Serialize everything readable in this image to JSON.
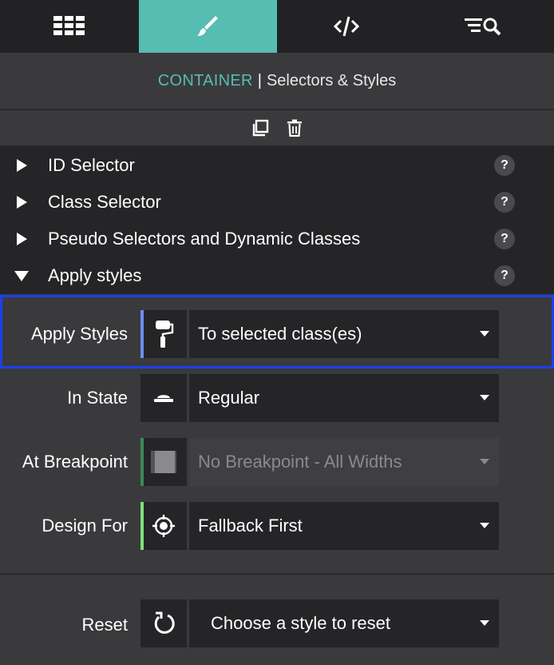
{
  "tabs": [
    {
      "name": "grid-icon",
      "active": false
    },
    {
      "name": "paintbrush-icon",
      "active": true
    },
    {
      "name": "code-icon",
      "active": false
    },
    {
      "name": "search-list-icon",
      "active": false
    }
  ],
  "header": {
    "context": "CONTAINER",
    "separator": "|",
    "title": "Selectors & Styles"
  },
  "toolbar": {
    "icons": [
      "duplicate-icon",
      "trash-icon"
    ]
  },
  "accordion": [
    {
      "label": "ID Selector",
      "expanded": false,
      "help": "?"
    },
    {
      "label": "Class Selector",
      "expanded": false,
      "help": "?"
    },
    {
      "label": "Pseudo Selectors and Dynamic Classes",
      "expanded": false,
      "help": "?"
    },
    {
      "label": "Apply styles",
      "expanded": true,
      "help": "?"
    }
  ],
  "form": {
    "apply_styles": {
      "label": "Apply Styles",
      "value": "To selected class(es)",
      "icon": "paint-roller-icon",
      "accent": "#6b8ff0"
    },
    "in_state": {
      "label": "In State",
      "value": "Regular",
      "icon": "state-icon"
    },
    "at_breakpoint": {
      "label": "At Breakpoint",
      "value": "No Breakpoint - All Widths",
      "icon": "breakpoint-icon",
      "accent": "#3c8a55",
      "disabled": true
    },
    "design_for": {
      "label": "Design For",
      "value": "Fallback First",
      "icon": "crosshair-icon",
      "accent": "#7fe07a"
    },
    "reset": {
      "label": "Reset",
      "value": "Choose a style to reset",
      "icon": "reset-icon"
    }
  },
  "colors": {
    "accent": "#56bdb3",
    "highlight_border": "#1c3ff0",
    "panel_dark": "#252527",
    "panel": "#3a3a3c"
  }
}
